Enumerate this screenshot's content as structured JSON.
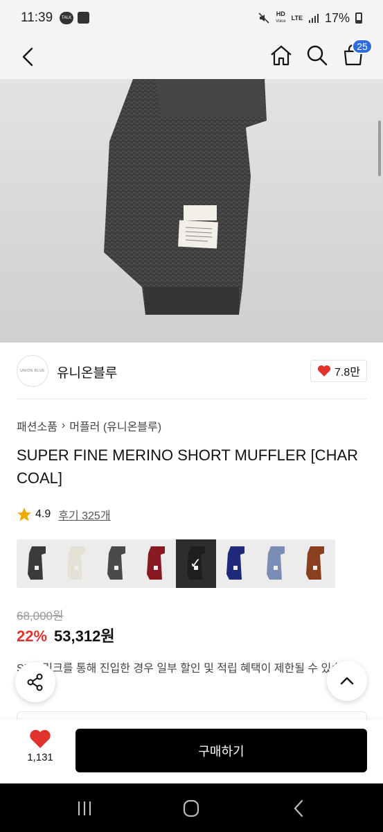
{
  "status_bar": {
    "time": "11:39",
    "talk_badge": "TALK",
    "hd_top": "HD",
    "hd_bottom": "Voice",
    "lte": "LTE",
    "battery": "17%"
  },
  "nav": {
    "cart_count": "25"
  },
  "brand": {
    "logo_text": "UNION BLUE",
    "name": "유니온블루",
    "like_count": "7.8만"
  },
  "breadcrumb": {
    "category": "패션소품",
    "separator": "›",
    "subcategory": "머플러 (유니온블루)"
  },
  "product": {
    "title": "SUPER FINE MERINO SHORT MUFFLER [CHARCOAL]",
    "rating": "4.9",
    "review_link": "후기 325개",
    "original_price": "68,000원",
    "discount": "22%",
    "sale_price": "53,312원",
    "notice": "SNS 링크를 통해 진입한 경우 일부 할인 및 적립 혜택이 제한될 수 있습니다."
  },
  "swatches": [
    {
      "color": "#3b3b3b",
      "selected": false
    },
    {
      "color": "#e6e1d6",
      "selected": false
    },
    {
      "color": "#4a4a4a",
      "selected": false
    },
    {
      "color": "#8a1a22",
      "selected": false
    },
    {
      "color": "#1e1e1e",
      "selected": true
    },
    {
      "color": "#1f2a7a",
      "selected": false
    },
    {
      "color": "#7b8db5",
      "selected": false
    },
    {
      "color": "#8a4020",
      "selected": false
    }
  ],
  "bottom": {
    "wish_count": "1,131",
    "buy_label": "구매하기"
  },
  "colors": {
    "accent_red": "#e0332d",
    "cart_badge": "#2d6cdf",
    "buy_button": "#000000"
  }
}
